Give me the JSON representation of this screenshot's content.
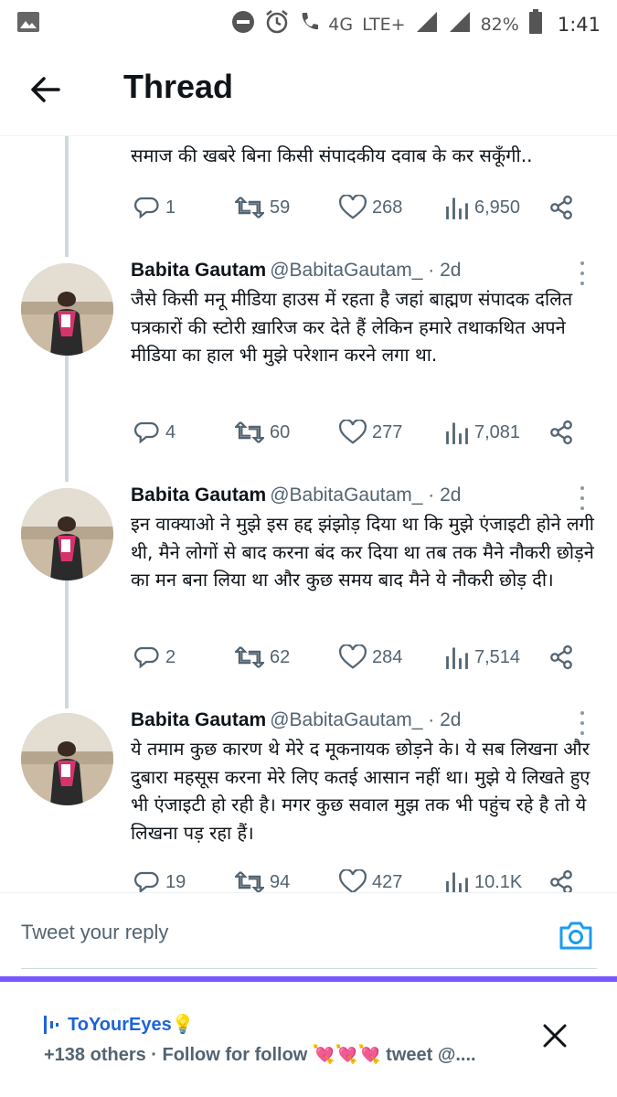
{
  "status_bar": {
    "network": "4G",
    "lte": "LTE+",
    "battery": "82%",
    "time": "1:41"
  },
  "header": {
    "title": "Thread"
  },
  "partial_tweet": {
    "text": "समाज की खबरे बिना किसी संपादकीय दवाब के कर सकूँगी..",
    "stats": {
      "replies": "1",
      "retweets": "59",
      "likes": "268",
      "views": "6,950"
    }
  },
  "tweets": [
    {
      "name": "Babita Gautam",
      "handle": "@BabitaGautam_ · 2d",
      "text": "जैसे किसी मनू मीडिया हाउस में रहता है जहां बाह्मण संपादक दलित पत्रकारों की स्टोरी ख़ारिज कर देते हैं लेकिन हमारे तथाकथित अपने मीडिया का हाल भी मुझे परेशान करने लगा था.",
      "stats": {
        "replies": "4",
        "retweets": "60",
        "likes": "277",
        "views": "7,081"
      }
    },
    {
      "name": "Babita Gautam",
      "handle": "@BabitaGautam_ · 2d",
      "text": "इन वाक्याओ ने मुझे इस हद्द झंझोड़ दिया था कि मुझे एंजाइटी होने लगी थी, मैने लोगों से बाद करना बंद कर दिया था तब तक मैने नौकरी छोड़ने का मन बना लिया था और कुछ समय बाद मैने ये नौकरी छोड़ दी।",
      "stats": {
        "replies": "2",
        "retweets": "62",
        "likes": "284",
        "views": "7,514"
      }
    },
    {
      "name": "Babita Gautam",
      "handle": "@BabitaGautam_ · 2d",
      "text": "ये तमाम कुछ कारण थे मेरे द मूकनायक छोड़ने के। ये सब लिखना और दुबारा महसूस करना मेरे लिए कतई आसान नहीं था। मुझे ये लिखते हुए भी एंजाइटी हो रही है। मगर कुछ सवाल मुझ तक भी पहुंच रहे है तो ये लिखना पड़ रहा हैं।",
      "stats": {
        "replies": "19",
        "retweets": "94",
        "likes": "427",
        "views": "10.1K"
      }
    }
  ],
  "reply": {
    "placeholder": "Tweet your reply"
  },
  "notification": {
    "title": "ToYourEyes💡",
    "subtitle": "+138 others · Follow for follow 💘💘💘 tweet @...."
  },
  "colors": {
    "accent": "#1d9bf0",
    "purple": "#7856ff",
    "muted": "#536471"
  }
}
